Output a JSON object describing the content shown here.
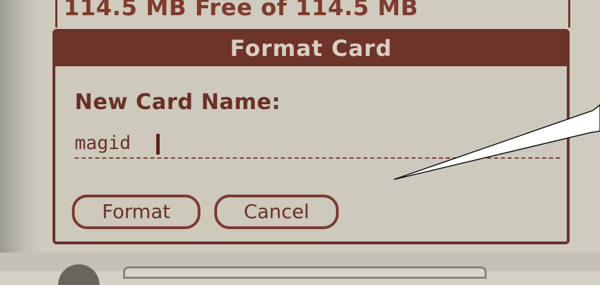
{
  "storage": {
    "status_text": "114.5 MB Free of 114.5 MB"
  },
  "dialog": {
    "title": "Format Card",
    "field_label": "New Card Name:",
    "card_name_value": "magid",
    "buttons": {
      "format_label": "Format",
      "cancel_label": "Cancel"
    }
  },
  "colors": {
    "dialog_frame": "#6b3127",
    "title_bar": "#6e342a",
    "text": "#6a3026",
    "screen_background": "#cfcbbf",
    "callout_fill": "#ffffff"
  }
}
